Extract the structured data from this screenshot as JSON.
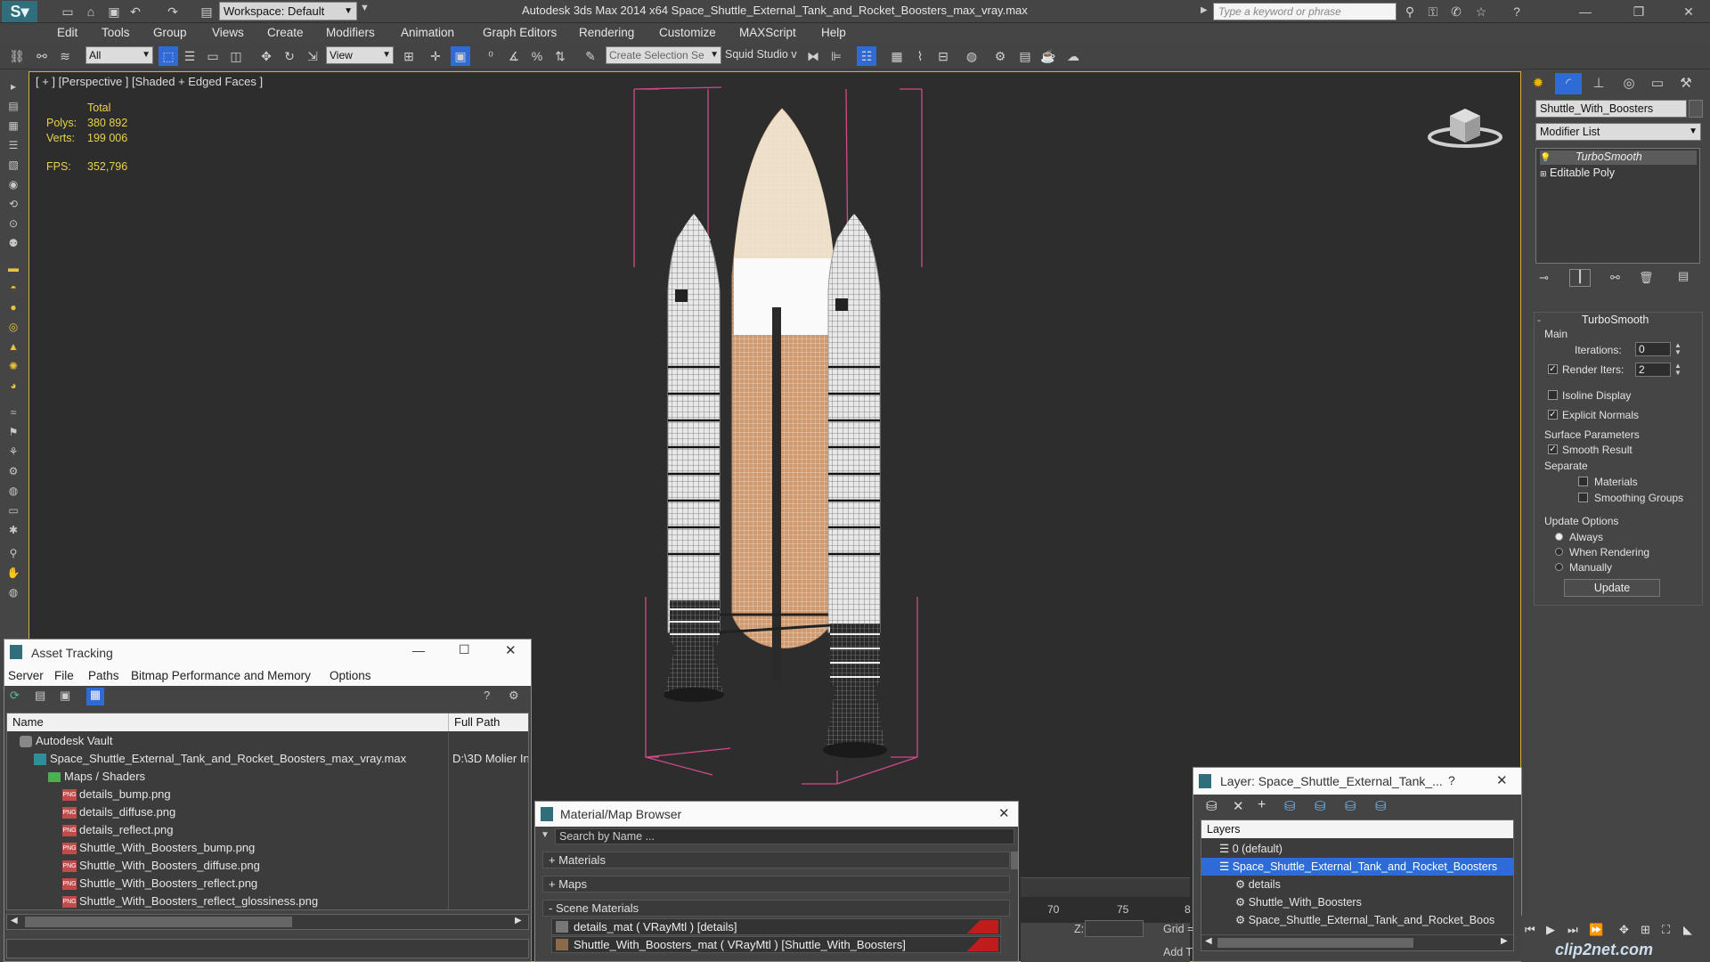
{
  "titlebar": {
    "workspace_label": "Workspace: Default",
    "app_title": "Autodesk 3ds Max  2014 x64     Space_Shuttle_External_Tank_and_Rocket_Boosters_max_vray.max",
    "search_placeholder": "Type a keyword or phrase"
  },
  "menu": [
    "Edit",
    "Tools",
    "Group",
    "Views",
    "Create",
    "Modifiers",
    "Animation",
    "Graph Editors",
    "Rendering",
    "Customize",
    "MAXScript",
    "Help"
  ],
  "toolbar": {
    "selection_filter": "All",
    "ref_coord": "View",
    "selection_set": "Create Selection Se",
    "studio_label": "Squid Studio v"
  },
  "viewport": {
    "label": "[ + ] [Perspective ] [Shaded + Edged Faces ]",
    "stats": {
      "total_label": "Total",
      "polys_label": "Polys:",
      "polys_value": "380 892",
      "verts_label": "Verts:",
      "verts_value": "199 006",
      "fps_label": "FPS:",
      "fps_value": "352,796"
    }
  },
  "command_panel": {
    "object_name": "Shuttle_With_Boosters",
    "modifier_list": "Modifier List",
    "stack": [
      "TurboSmooth",
      "Editable Poly"
    ],
    "turbosmooth": {
      "title": "TurboSmooth",
      "main_label": "Main",
      "iterations_label": "Iterations:",
      "iterations_value": "0",
      "render_iters_label": "Render Iters:",
      "render_iters_value": "2",
      "isoline_label": "Isoline Display",
      "explicit_normals_label": "Explicit Normals",
      "surface_params_label": "Surface Parameters",
      "smooth_result_label": "Smooth Result",
      "separate_label": "Separate",
      "materials_label": "Materials",
      "smoothing_groups_label": "Smoothing Groups",
      "update_options_label": "Update Options",
      "always_label": "Always",
      "when_rendering_label": "When Rendering",
      "manually_label": "Manually",
      "update_button": "Update"
    }
  },
  "asset_tracking": {
    "title": "Asset Tracking",
    "menu": [
      "Server",
      "File",
      "Paths",
      "Bitmap Performance and Memory",
      "Options"
    ],
    "col_name": "Name",
    "col_path": "Full Path",
    "rows": [
      {
        "name": "Autodesk Vault",
        "path": "",
        "indent": 0,
        "type": "vault"
      },
      {
        "name": "Space_Shuttle_External_Tank_and_Rocket_Boosters_max_vray.max",
        "path": "D:\\3D Molier In",
        "indent": 1,
        "type": "max"
      },
      {
        "name": "Maps / Shaders",
        "path": "",
        "indent": 2,
        "type": "folder"
      },
      {
        "name": "details_bump.png",
        "path": "",
        "indent": 3,
        "type": "png"
      },
      {
        "name": "details_diffuse.png",
        "path": "",
        "indent": 3,
        "type": "png"
      },
      {
        "name": "details_reflect.png",
        "path": "",
        "indent": 3,
        "type": "png"
      },
      {
        "name": "Shuttle_With_Boosters_bump.png",
        "path": "",
        "indent": 3,
        "type": "png"
      },
      {
        "name": "Shuttle_With_Boosters_diffuse.png",
        "path": "",
        "indent": 3,
        "type": "png"
      },
      {
        "name": "Shuttle_With_Boosters_reflect.png",
        "path": "",
        "indent": 3,
        "type": "png"
      },
      {
        "name": "Shuttle_With_Boosters_reflect_glossiness.png",
        "path": "",
        "indent": 3,
        "type": "png"
      }
    ],
    "png_badge": "PNG"
  },
  "material_browser": {
    "title": "Material/Map Browser",
    "search_placeholder": "Search by Name ...",
    "groups": [
      "+ Materials",
      "+ Maps",
      "- Scene Materials"
    ],
    "items": [
      "details_mat  ( VRayMtl )  [details]",
      "Shuttle_With_Boosters_mat  ( VRayMtl )  [Shuttle_With_Boosters]"
    ]
  },
  "layer_window": {
    "title": "Layer: Space_Shuttle_External_Tank_...",
    "help": "?",
    "header": "Layers",
    "rows": [
      {
        "name": "0 (default)",
        "indent": 0,
        "selected": false
      },
      {
        "name": "Space_Shuttle_External_Tank_and_Rocket_Boosters",
        "indent": 0,
        "selected": true
      },
      {
        "name": "details",
        "indent": 1,
        "selected": false
      },
      {
        "name": "Shuttle_With_Boosters",
        "indent": 1,
        "selected": false
      },
      {
        "name": "Space_Shuttle_External_Tank_and_Rocket_Boos",
        "indent": 1,
        "selected": false
      }
    ]
  },
  "timeline": {
    "ticks": [
      "70",
      "75",
      "8"
    ],
    "z_label": "Z:",
    "grid_label": "Grid =",
    "add_label": "Add T"
  },
  "watermark": "clip2net.com",
  "colors": {
    "selection_blue": "#2f6bd6",
    "stat_yellow": "#e8d24a",
    "bbox_pink": "#d24a8a",
    "viewport_border": "#d4b33a"
  }
}
